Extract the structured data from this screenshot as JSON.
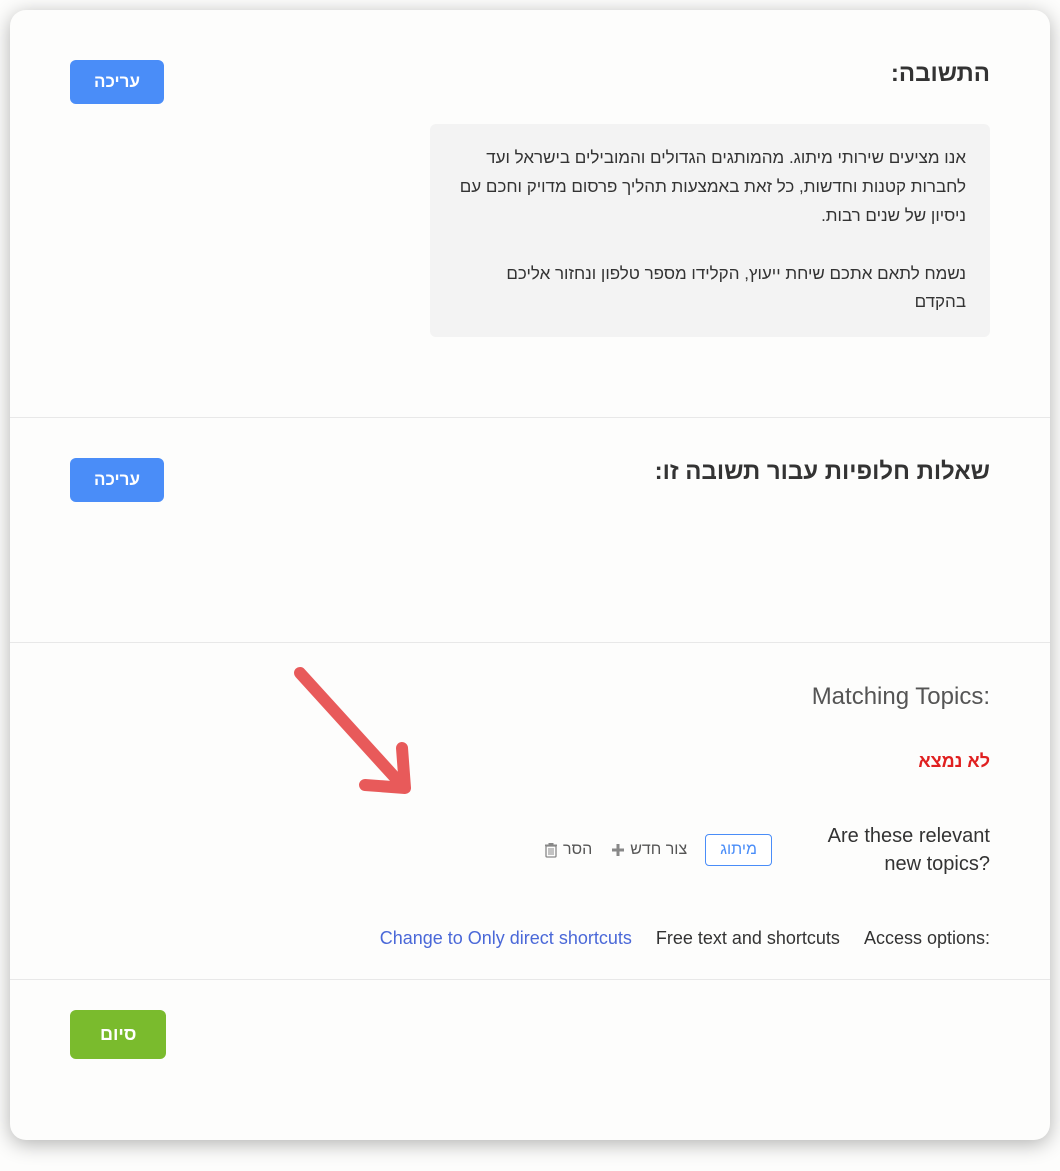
{
  "answer_section": {
    "title": "התשובה:",
    "edit_button": "עריכה",
    "answer_text": "אנו מציעים שירותי מיתוג. מהמותגים הגדולים והמובילים בישראל ועד לחברות קטנות וחדשות, כל זאת באמצעות תהליך פרסום מדויק וחכם עם ניסיון של שנים רבות.\n\nנשמח לתאם אתכם שיחת ייעוץ, הקלידו מספר טלפון ונחזור אליכם בהקדם"
  },
  "alt_questions_section": {
    "title": "שאלות חלופיות עבור תשובה זו:",
    "edit_button": "עריכה"
  },
  "matching_section": {
    "title": "Matching Topics:",
    "not_found": "לא נמצא",
    "new_topics_label": "Are these relevant new topics?",
    "topic_chip": "מיתוג",
    "create_new": "צור חדש",
    "remove": "הסר",
    "access_label": "Access options:",
    "access_current": "Free text and shortcuts",
    "access_link": "Change to Only direct shortcuts"
  },
  "footer": {
    "finish_button": "סיום"
  }
}
